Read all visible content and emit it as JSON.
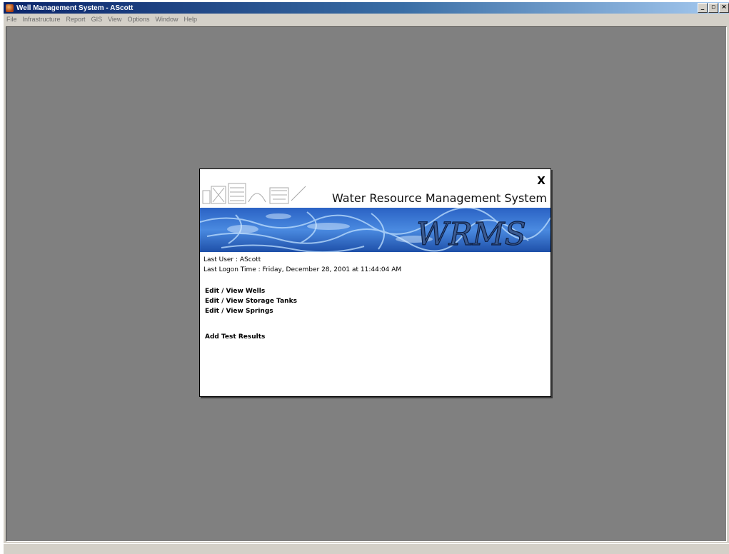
{
  "window": {
    "title": "Well Management System - AScott",
    "controls": [
      "minimize-icon",
      "restore-icon",
      "close-icon"
    ]
  },
  "menu": {
    "items": [
      "File",
      "Infrastructure",
      "Report",
      "GIS",
      "View",
      "Options",
      "Window",
      "Help"
    ]
  },
  "dialog": {
    "close_label": "X",
    "system_title": "Water Resource Management System",
    "banner_logo": "WRMS",
    "last_user": "Last User : AScott",
    "last_logon": "Last Logon Time : Friday, December 28, 2001 at 11:44:04 AM",
    "links": [
      "Edit / View Wells",
      "Edit / View Storage Tanks",
      "Edit / View Springs",
      "Add Test Results"
    ]
  },
  "colors": {
    "desktop": "#808080",
    "chrome": "#d4d0c8",
    "banner_water": "#3a7ad8"
  }
}
